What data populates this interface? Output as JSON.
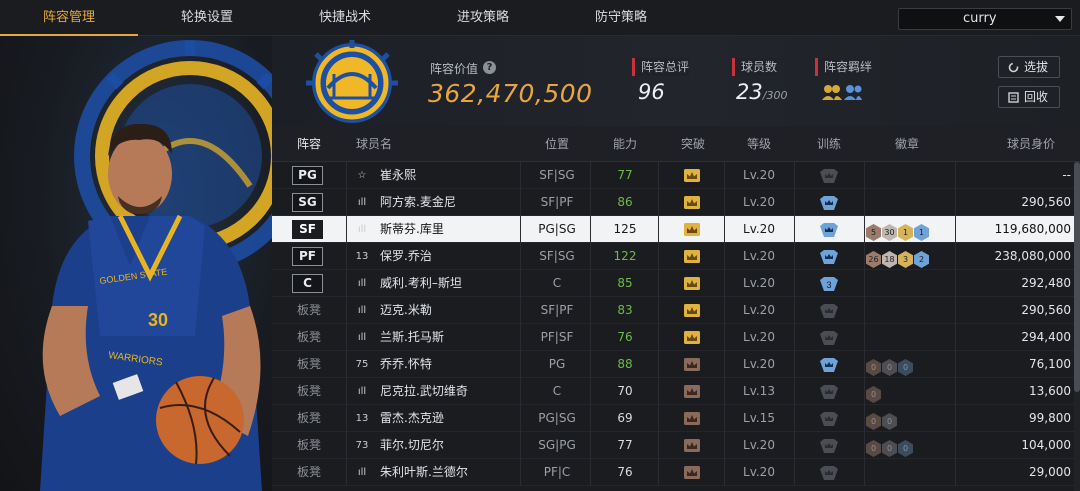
{
  "nav": {
    "tabs": [
      "阵容管理",
      "轮换设置",
      "快捷战术",
      "进攻策略",
      "防守策略"
    ],
    "active_tab": 0,
    "search_value": "curry"
  },
  "header": {
    "value_label": "阵容价值",
    "value": "362,470,500",
    "overall_label": "阵容总评",
    "overall": "96",
    "players_label": "球员数",
    "players": "23",
    "players_max": "/300",
    "chem_label": "阵容羁绊",
    "select_button": "选拔",
    "recycle_button": "回收"
  },
  "table": {
    "headers": [
      "阵容",
      "球员名",
      "位置",
      "能力",
      "突破",
      "等级",
      "训练",
      "徽章",
      "球员身价"
    ],
    "rows": [
      {
        "slot": "PG",
        "num": "☆",
        "name": "崔永熙",
        "pos": "SF|SG",
        "ability": "77",
        "green": true,
        "crown": "gold",
        "level": "Lv.20",
        "train": "grey",
        "badges": [],
        "price": "--",
        "bench": false
      },
      {
        "slot": "SG",
        "num": "ıll",
        "name": "阿方索.麦金尼",
        "pos": "SF|PF",
        "ability": "86",
        "green": true,
        "crown": "gold",
        "level": "Lv.20",
        "train": "blue",
        "badges": [],
        "price": "290,560",
        "bench": false
      },
      {
        "slot": "SF",
        "num": "ıll",
        "name": "斯蒂芬.库里",
        "pos": "PG|SG",
        "ability": "125",
        "green": false,
        "crown": "gold",
        "level": "Lv.20",
        "train": "blue",
        "badges": [
          [
            "5",
            "#9c7b6a"
          ],
          [
            "30",
            "#bfb6b0"
          ],
          [
            "1",
            "#d6b35a"
          ],
          [
            "1",
            "#6ea2d8"
          ]
        ],
        "price": "119,680,000",
        "bench": false
      },
      {
        "slot": "PF",
        "num": "13",
        "name": "保罗.乔治",
        "pos": "SF|SG",
        "ability": "122",
        "green": true,
        "crown": "gold",
        "level": "Lv.20",
        "train": "blue",
        "badges": [
          [
            "26",
            "#9c7b6a"
          ],
          [
            "18",
            "#bfb6b0"
          ],
          [
            "3",
            "#d6b35a"
          ],
          [
            "2",
            "#6ea2d8"
          ]
        ],
        "price": "238,080,000",
        "bench": false
      },
      {
        "slot": "C",
        "num": "ıll",
        "name": "威利.考利–斯坦",
        "pos": "C",
        "ability": "85",
        "green": true,
        "crown": "gold",
        "level": "Lv.20",
        "train": "blue3",
        "badges": [],
        "price": "292,480",
        "bench": false
      },
      {
        "slot": "板凳",
        "num": "ıll",
        "name": "迈克.米勒",
        "pos": "SF|PF",
        "ability": "83",
        "green": true,
        "crown": "gold",
        "level": "Lv.20",
        "train": "grey",
        "badges": [],
        "price": "290,560",
        "bench": true
      },
      {
        "slot": "板凳",
        "num": "ıll",
        "name": "兰斯.托马斯",
        "pos": "PF|SF",
        "ability": "76",
        "green": true,
        "crown": "gold",
        "level": "Lv.20",
        "train": "grey",
        "badges": [],
        "price": "294,400",
        "bench": true
      },
      {
        "slot": "板凳",
        "num": "75",
        "name": "乔乔.怀特",
        "pos": "PG",
        "ability": "88",
        "green": true,
        "crown": "brown",
        "level": "Lv.20",
        "train": "blue",
        "badges": [
          [
            "0",
            "#5a4a42"
          ],
          [
            "0",
            "#4d4d52"
          ],
          [
            "0",
            "#3a4c60"
          ]
        ],
        "price": "76,100",
        "bench": true
      },
      {
        "slot": "板凳",
        "num": "ıll",
        "name": "尼克拉.武切维奇",
        "pos": "C",
        "ability": "70",
        "green": false,
        "crown": "brown",
        "level": "Lv.13",
        "train": "grey",
        "badges": [
          [
            "0",
            "#5a4a42"
          ]
        ],
        "price": "13,600",
        "bench": true
      },
      {
        "slot": "板凳",
        "num": "13",
        "name": "雷杰.杰克逊",
        "pos": "PG|SG",
        "ability": "69",
        "green": false,
        "crown": "brown",
        "level": "Lv.15",
        "train": "grey",
        "badges": [
          [
            "0",
            "#5a4a42"
          ],
          [
            "0",
            "#4d4d52"
          ]
        ],
        "price": "99,800",
        "bench": true
      },
      {
        "slot": "板凳",
        "num": "73",
        "name": "菲尔.切尼尔",
        "pos": "SG|PG",
        "ability": "77",
        "green": false,
        "crown": "brown",
        "level": "Lv.20",
        "train": "grey",
        "badges": [
          [
            "0",
            "#5a4a42"
          ],
          [
            "0",
            "#4d4d52"
          ],
          [
            "0",
            "#3a4c60"
          ]
        ],
        "price": "104,000",
        "bench": true
      },
      {
        "slot": "板凳",
        "num": "ıll",
        "name": "朱利叶斯.兰德尔",
        "pos": "PF|C",
        "ability": "76",
        "green": false,
        "crown": "brown",
        "level": "Lv.20",
        "train": "grey",
        "badges": [],
        "price": "29,000",
        "bench": true
      }
    ]
  },
  "colors": {
    "accent": "#e5a93a",
    "green": "#6dbb4a",
    "red": "#c8323a"
  }
}
